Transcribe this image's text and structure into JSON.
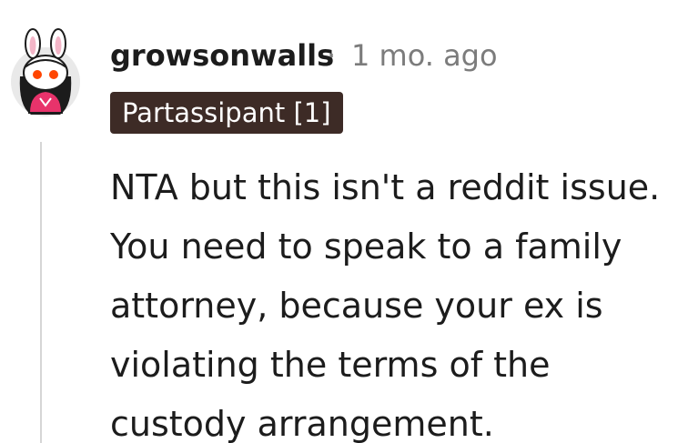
{
  "comment": {
    "username": "growsonwalls",
    "separator": "·",
    "timestamp": "1 mo. ago",
    "flair": "Partassipant [1]",
    "body_lines": [
      "NTA but this isn't a reddit issue.",
      "You need to speak to a family",
      "attorney, because your ex is",
      "violating the terms of the",
      "custody arrangement."
    ]
  },
  "colors": {
    "username": "#1c1c1c",
    "meta": "#7c7c7c",
    "flair_bg": "#3d2b26",
    "flair_text": "#ffffff",
    "thread_line": "#d6d6d6",
    "avatar_accent": "#e8336b"
  },
  "icons": {
    "avatar": "snoo-bunny-avatar-icon"
  }
}
